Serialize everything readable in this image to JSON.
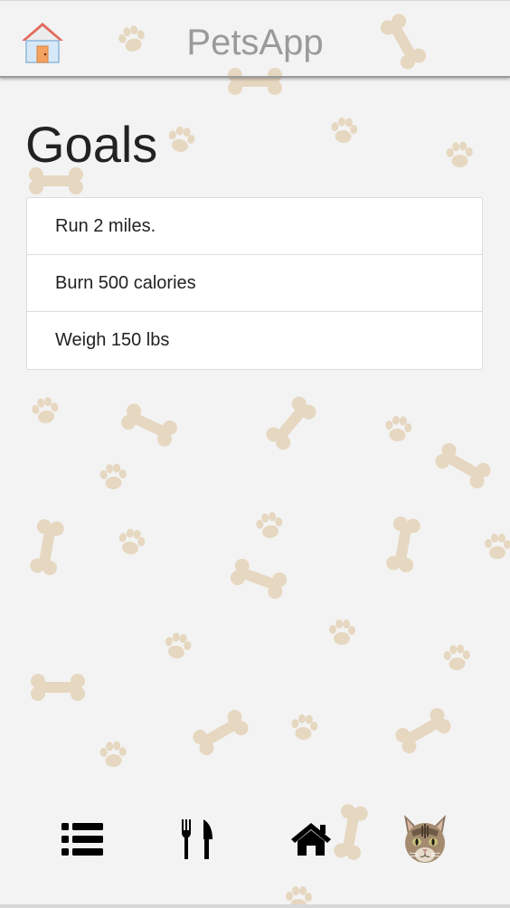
{
  "app": {
    "title": "PetsApp"
  },
  "page": {
    "title": "Goals"
  },
  "goals": [
    "Run 2 miles.",
    "Burn 500 calories",
    "Weigh 150 lbs"
  ],
  "navbar": {
    "home_icon": "house-door-icon"
  },
  "bottom_nav": {
    "items": [
      {
        "icon": "list-icon"
      },
      {
        "icon": "fork-knife-icon"
      },
      {
        "icon": "home-icon"
      },
      {
        "icon": "cat-avatar-icon"
      }
    ]
  },
  "colors": {
    "background": "#f3f3f3",
    "pattern": "#e6d7c0",
    "title_gray": "#9a9a9a",
    "text": "#222222"
  }
}
